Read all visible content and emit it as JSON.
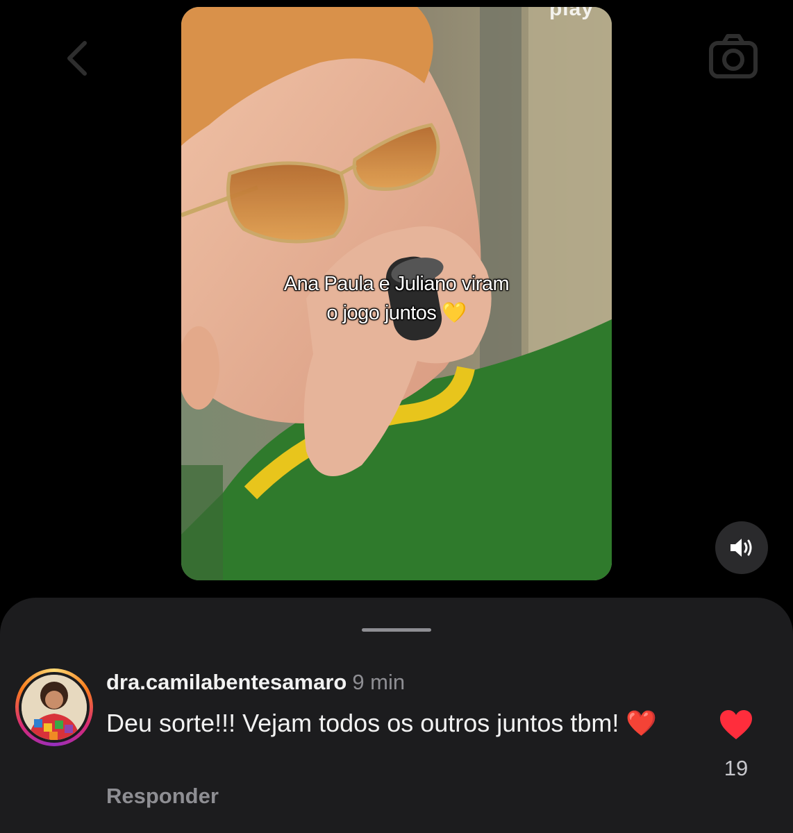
{
  "video": {
    "brand_text": "play",
    "caption_line1": "Ana Paula e Juliano viram",
    "caption_line2": "o jogo juntos",
    "caption_emoji": "💛"
  },
  "icons": {
    "back": "chevron-left-icon",
    "camera": "camera-icon",
    "sound": "speaker-icon",
    "like": "heart-icon"
  },
  "comment": {
    "username": "dra.camilabentesamaro",
    "time": "9 min",
    "text": "Deu sorte!!! Vejam todos os outros juntos tbm!",
    "text_emoji": "❤️",
    "reply_label": "Responder",
    "like_count": "19",
    "liked": true
  },
  "colors": {
    "background": "#000000",
    "sheet": "#1c1c1e",
    "like_red": "#ff2d55",
    "muted_text": "#8e8e93"
  }
}
